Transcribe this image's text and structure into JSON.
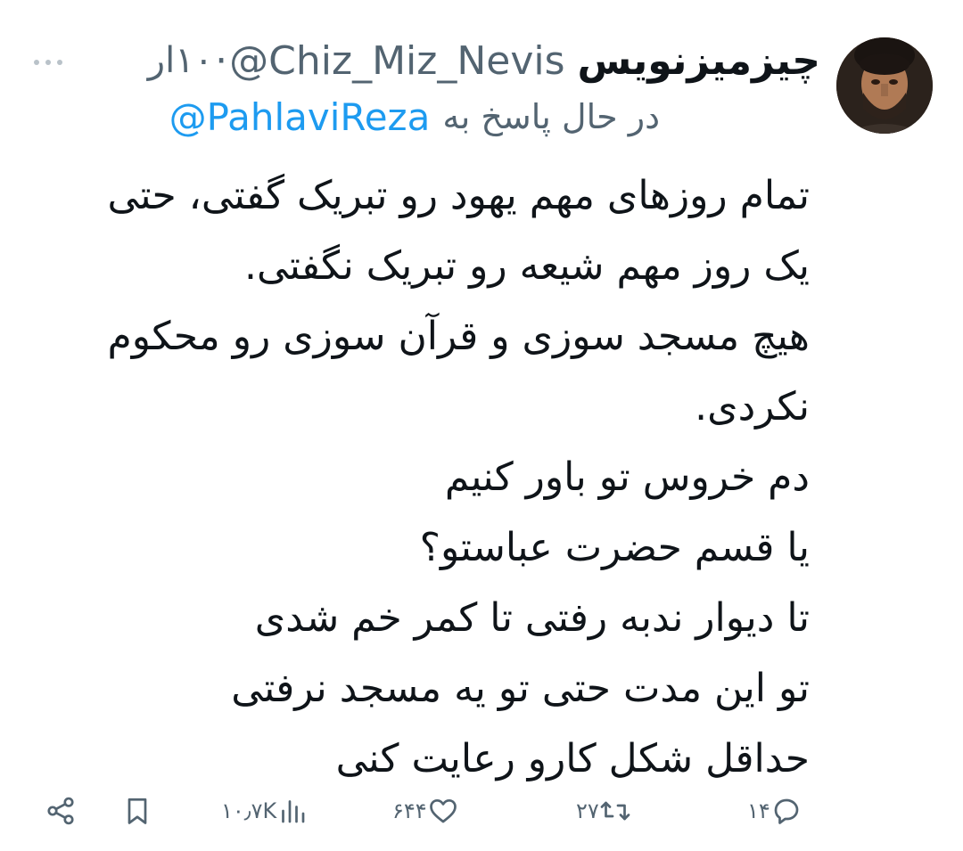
{
  "author": {
    "display_name": "چیزمیزنویس",
    "handle": "@Chiz_Miz_Nevis",
    "timestamp": "۱۰ار",
    "separator": "·"
  },
  "reply_to": {
    "prefix": "در حال پاسخ به",
    "mention": "@PahlaviReza"
  },
  "body_lines": [
    "تمام روزهای مهم یهود رو تبریک گفتی، حتی",
    "یک روز مهم شیعه رو تبریک نگفتی.",
    "هیچ مسجد سوزی و قرآن سوزی رو محکوم",
    "نکردی.",
    "دم خروس تو باور کنیم",
    "یا قسم حضرت عباستو؟",
    "تا دیوار ندبه رفتی تا کمر خم شدی",
    "تو این مدت حتی تو یه مسجد نرفتی",
    "حداقل شکل کارو رعایت کنی"
  ],
  "actions": {
    "replies": "۱۴",
    "retweets": "۲۷",
    "likes": "۶۴۴",
    "views": "۱۰٫۷K"
  },
  "icons": {
    "more": "more-icon",
    "reply": "reply-icon",
    "retweet": "retweet-icon",
    "like": "heart-icon",
    "views": "views-icon",
    "bookmark": "bookmark-icon",
    "share": "share-icon"
  },
  "colors": {
    "text": "#0f1419",
    "secondary": "#536471",
    "link": "#1d9bf0"
  }
}
